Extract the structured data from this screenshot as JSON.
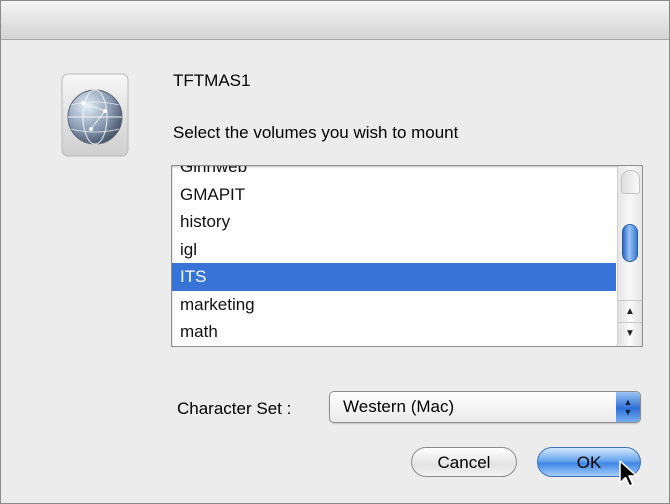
{
  "dialog": {
    "server_name": "TFTMAS1",
    "prompt": "Select the volumes you wish to mount"
  },
  "volumes": {
    "items": [
      {
        "label": "Ginnweb",
        "selected": false
      },
      {
        "label": "GMAPIT",
        "selected": false
      },
      {
        "label": "history",
        "selected": false
      },
      {
        "label": "igl",
        "selected": false
      },
      {
        "label": "ITS",
        "selected": true
      },
      {
        "label": "marketing",
        "selected": false
      },
      {
        "label": "math",
        "selected": false
      }
    ]
  },
  "charset": {
    "label": "Character Set :",
    "value": "Western (Mac)"
  },
  "buttons": {
    "cancel": "Cancel",
    "ok": "OK"
  },
  "colors": {
    "selection": "#3874d8",
    "default_button": "#3f86e5"
  },
  "icons": {
    "server": "network-globe-icon",
    "popup": "up-down-arrows-icon",
    "cursor": "arrow-cursor-icon"
  }
}
